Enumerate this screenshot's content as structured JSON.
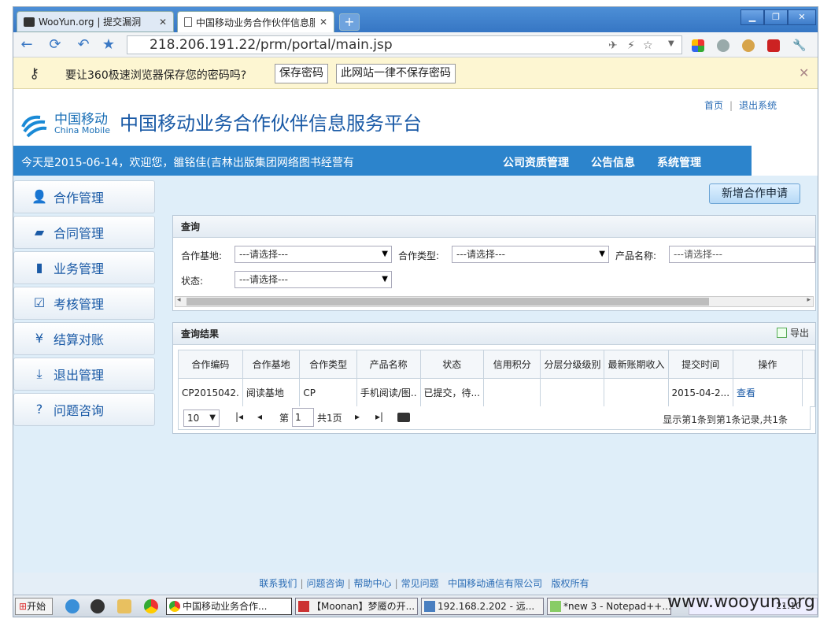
{
  "browser": {
    "tabs": [
      {
        "title": "WooYun.org | 提交漏洞",
        "active": false
      },
      {
        "title": "中国移动业务合作伙伴信息服",
        "active": true
      }
    ],
    "new_tab": "+",
    "url": "218.206.191.22/prm/portal/main.jsp",
    "window_controls": {
      "min": "▁",
      "max": "❐",
      "close": "✕"
    }
  },
  "password_bar": {
    "message": "要让360极速浏览器保存您的密码吗?",
    "save_label": "保存密码",
    "never_label": "此网站一律不保存密码",
    "close": "✕"
  },
  "header": {
    "logo_cn": "中国移动",
    "logo_en": "China Mobile",
    "site_title": "中国移动业务合作伙伴信息服务平台",
    "link_home": "首页",
    "link_sep": "|",
    "link_logout": "退出系统"
  },
  "navbar": {
    "welcome": "今天是2015-06-14，欢迎您，雒铭佳(吉林出版集团网络图书经营有",
    "items": [
      "公司资质管理",
      "公告信息",
      "系统管理"
    ]
  },
  "sidebar": {
    "items": [
      {
        "label": "合作管理",
        "icon": "user-icon"
      },
      {
        "label": "合同管理",
        "icon": "folder-icon"
      },
      {
        "label": "业务管理",
        "icon": "book-icon"
      },
      {
        "label": "考核管理",
        "icon": "checkbox-icon"
      },
      {
        "label": "结算对账",
        "icon": "yen-icon"
      },
      {
        "label": "退出管理",
        "icon": "download-icon"
      },
      {
        "label": "问题咨询",
        "icon": "question-icon"
      }
    ]
  },
  "actions": {
    "new_apply": "新增合作申请"
  },
  "query": {
    "title": "查询",
    "base_label": "合作基地:",
    "base_value": "---请选择---",
    "type_label": "合作类型:",
    "type_value": "---请选择---",
    "product_label": "产品名称:",
    "product_placeholder": "---请选择---",
    "status_label": "状态:",
    "status_value": "---请选择---"
  },
  "results": {
    "title": "查询结果",
    "export": "导出",
    "columns": [
      "合作编码",
      "合作基地",
      "合作类型",
      "产品名称",
      "状态",
      "信用积分",
      "分层分级级别",
      "最新账期收入",
      "提交时间",
      "操作"
    ],
    "rows": [
      [
        "CP2015042.",
        "阅读基地",
        "CP",
        "手机阅读/图..",
        "已提交，待...",
        "",
        "",
        "",
        "2015-04-2...",
        "查看"
      ]
    ],
    "pager": {
      "page_size": "10",
      "page_prefix": "第",
      "page_num": "1",
      "page_total": "共1页",
      "info": "显示第1条到第1条记录,共1条"
    }
  },
  "footer": {
    "links": [
      "联系我们",
      "问题咨询",
      "帮助中心",
      "常见问题",
      "中国移动通信有限公司",
      "版权所有"
    ]
  },
  "taskbar": {
    "start": "开始",
    "tasks": [
      "中国移动业务合作...",
      "【Moonan】梦魇の开...",
      "192.168.2.202 - 远...",
      "*new  3 - Notepad++..."
    ],
    "tray_time": "21:10"
  },
  "watermark": "www.wooyun.org"
}
